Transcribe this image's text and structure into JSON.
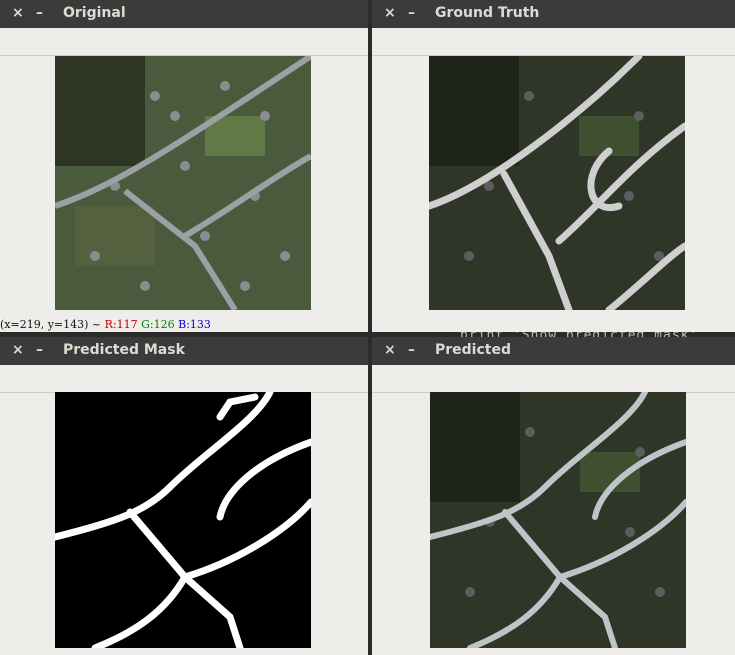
{
  "windows": {
    "original": {
      "title": "Original",
      "close_glyph": "×",
      "min_glyph": "–"
    },
    "ground_truth": {
      "title": "Ground Truth",
      "close_glyph": "×",
      "min_glyph": "–"
    },
    "predicted_mask": {
      "title": "Predicted Mask",
      "close_glyph": "×",
      "min_glyph": "–"
    },
    "predicted": {
      "title": "Predicted",
      "close_glyph": "×",
      "min_glyph": "–"
    }
  },
  "status": {
    "coords": "(x=219, y=143) ~ ",
    "r": "R:117",
    "g": "G:126",
    "b": "B:133"
  },
  "background_text": "print 'Show predicted mask'",
  "colors": {
    "titlebar": "#3b3b3b",
    "window_bg": "#efedea",
    "road_white": "#ffffff",
    "road_overlay": "#c8c8c8"
  }
}
